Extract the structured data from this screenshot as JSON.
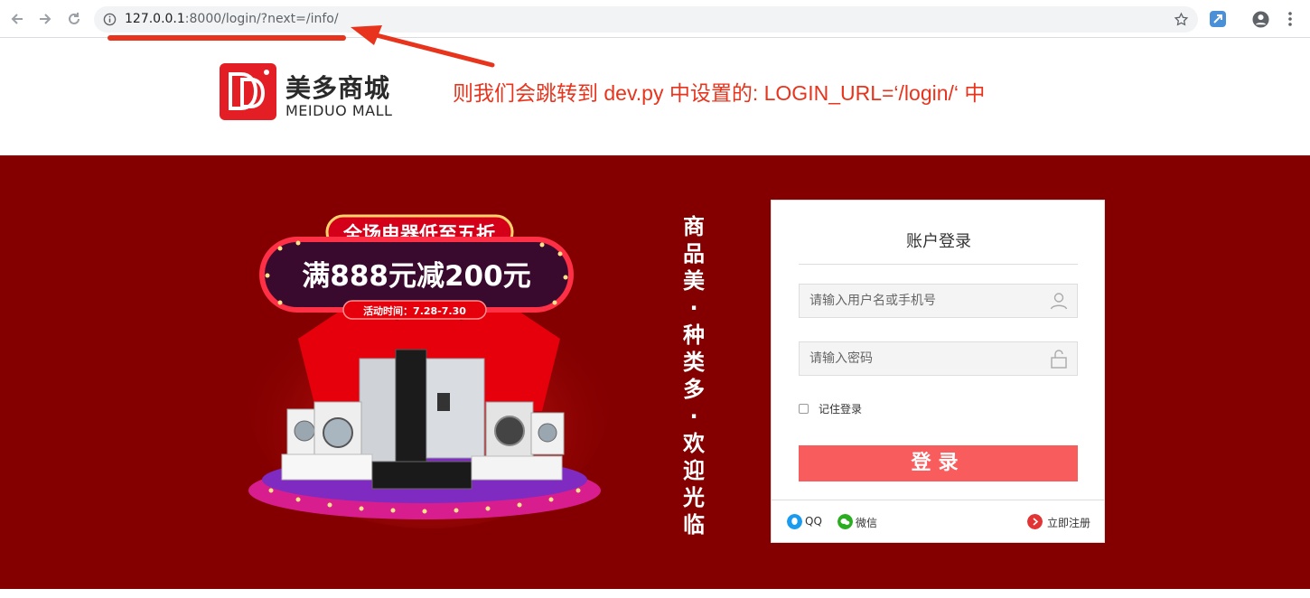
{
  "browser": {
    "url_host": "127.0.0.1",
    "url_rest": ":8000/login/?next=/info/",
    "back_icon": "arrow-left-icon",
    "forward_icon": "arrow-right-icon",
    "reload_icon": "reload-icon",
    "info_icon": "info-icon",
    "bookmark_icon": "star-icon",
    "menu_icon": "kebab-menu-icon"
  },
  "annotation": {
    "text": "则我们会跳转到 dev.py 中设置的: LOGIN_URL=‘/login/‘ 中",
    "color": "#e8341d"
  },
  "header": {
    "logo_title": "美多商城",
    "logo_subtitle": "MEIDUO MALL",
    "logo_color": "#e31e24"
  },
  "banner": {
    "background": "#840000",
    "promo_headline": "全场电器低至五折",
    "promo_main": "满888元减200元",
    "promo_date": "活动时间：7.28-7.30",
    "slogan": [
      "商",
      "品",
      "美",
      "·",
      "种",
      "类",
      "多",
      "·",
      "欢",
      "迎",
      "光",
      "临"
    ]
  },
  "login": {
    "title": "账户登录",
    "username_placeholder": "请输入用户名或手机号",
    "password_placeholder": "请输入密码",
    "remember_label": "记住登录",
    "submit_label": "登录",
    "button_color": "#f85c5c",
    "qq_label": "QQ",
    "wechat_label": "微信",
    "register_label": "立即注册"
  }
}
